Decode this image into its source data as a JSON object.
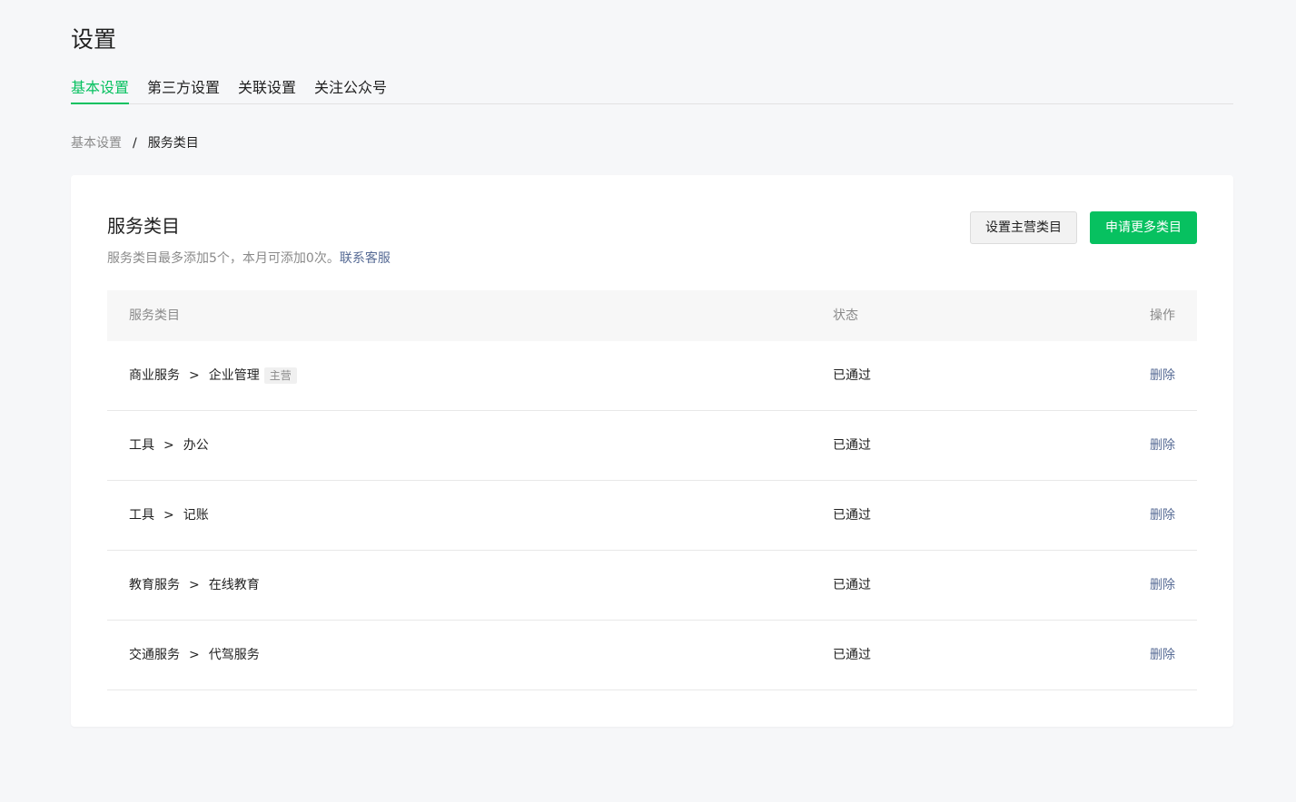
{
  "page": {
    "title": "设置"
  },
  "tabs": [
    {
      "label": "基本设置",
      "active": true
    },
    {
      "label": "第三方设置",
      "active": false
    },
    {
      "label": "关联设置",
      "active": false
    },
    {
      "label": "关注公众号",
      "active": false
    }
  ],
  "breadcrumb": {
    "parent": "基本设置",
    "separator": "/",
    "current": "服务类目"
  },
  "card": {
    "title": "服务类目",
    "desc": "服务类目最多添加5个，本月可添加0次。",
    "desc_link": "联系客服",
    "btn_set_main": "设置主营类目",
    "btn_apply_more": "申请更多类目"
  },
  "table": {
    "headers": {
      "category": "服务类目",
      "status": "状态",
      "action": "操作"
    },
    "arrow": ">",
    "rows": [
      {
        "primary": "商业服务",
        "secondary": "企业管理",
        "badge": "主营",
        "status": "已通过",
        "action": "删除"
      },
      {
        "primary": "工具",
        "secondary": "办公",
        "badge": "",
        "status": "已通过",
        "action": "删除"
      },
      {
        "primary": "工具",
        "secondary": "记账",
        "badge": "",
        "status": "已通过",
        "action": "删除"
      },
      {
        "primary": "教育服务",
        "secondary": "在线教育",
        "badge": "",
        "status": "已通过",
        "action": "删除"
      },
      {
        "primary": "交通服务",
        "secondary": "代驾服务",
        "badge": "",
        "status": "已通过",
        "action": "删除"
      }
    ]
  },
  "colors": {
    "accent": "#07c160",
    "link": "#576b95",
    "muted": "#8a8a8a",
    "background": "#f6f7f9"
  }
}
